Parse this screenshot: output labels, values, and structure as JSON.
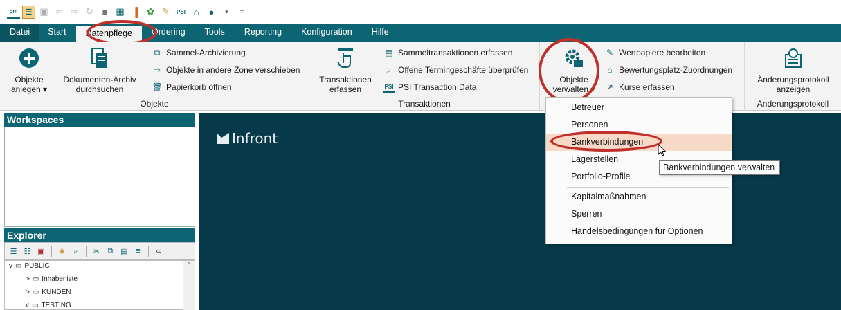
{
  "qat": {
    "icons": [
      "pm-icon",
      "tree-icon",
      "save-icon",
      "back-icon",
      "forward-icon",
      "refresh-icon",
      "stop-icon",
      "grid-icon",
      "chart-icon",
      "globe-icon",
      "edit-icon",
      "psi-icon",
      "bank-icon",
      "world-icon",
      "dropdown-icon"
    ],
    "pm_label": "pm",
    "psi_label": "PSI"
  },
  "tabs": [
    "Datei",
    "Start",
    "Datenpflege",
    "Ordering",
    "Tools",
    "Reporting",
    "Konfiguration",
    "Hilfe"
  ],
  "active_tab": "Datenpflege",
  "ribbon": {
    "objekte": {
      "label": "Objekte",
      "anlegen": "Objekte",
      "anlegen2": "anlegen ▾",
      "dokarchiv": "Dokumenten-Archiv",
      "dokarchiv2": "durchsuchen",
      "sammel": "Sammel-Archivierung",
      "zone": "Objekte in andere Zone verschieben",
      "papierkorb": "Papierkorb öffnen"
    },
    "transaktionen": {
      "label": "Transaktionen",
      "erfassen": "Transaktionen",
      "erfassen2": "erfassen",
      "sammel": "Sammeltransaktionen erfassen",
      "termin": "Offene Termingeschäfte überprüfen",
      "psi": "PSI Transaction Data"
    },
    "verwalten": {
      "btn": "Objekte",
      "btn2": "verwalten ▾",
      "wp": "Wertpapiere bearbeiten",
      "bew": "Bewertungsplatz-Zuordnungen",
      "kurse": "Kurse erfassen"
    },
    "aenderung": {
      "label": "Änderungsprotokoll",
      "btn": "Änderungsprotokoll",
      "btn2": "anzeigen"
    }
  },
  "panels": {
    "workspaces": "Workspaces",
    "explorer": "Explorer"
  },
  "tree": [
    {
      "label": "PUBLIC",
      "expander": "v"
    },
    {
      "label": "Inhaberliste",
      "expander": ">"
    },
    {
      "label": "KUNDEN",
      "expander": ">"
    },
    {
      "label": "TESTING",
      "expander": "v"
    }
  ],
  "brand": "Infront",
  "menu": {
    "items": [
      "Betreuer",
      "Personen",
      "Bankverbindungen",
      "Lagerstellen",
      "Portfolio-Profile",
      "Kapitalmaßnahmen",
      "Sperren",
      "Handelsbedingungen für Optionen"
    ],
    "highlighted": "Bankverbindungen"
  },
  "tooltip": "Bankverbindungen verwalten",
  "colors": {
    "accent": "#0d6472",
    "main_bg": "#063a4b",
    "highlight": "#f6d9c6",
    "annotation": "#c0302b"
  }
}
